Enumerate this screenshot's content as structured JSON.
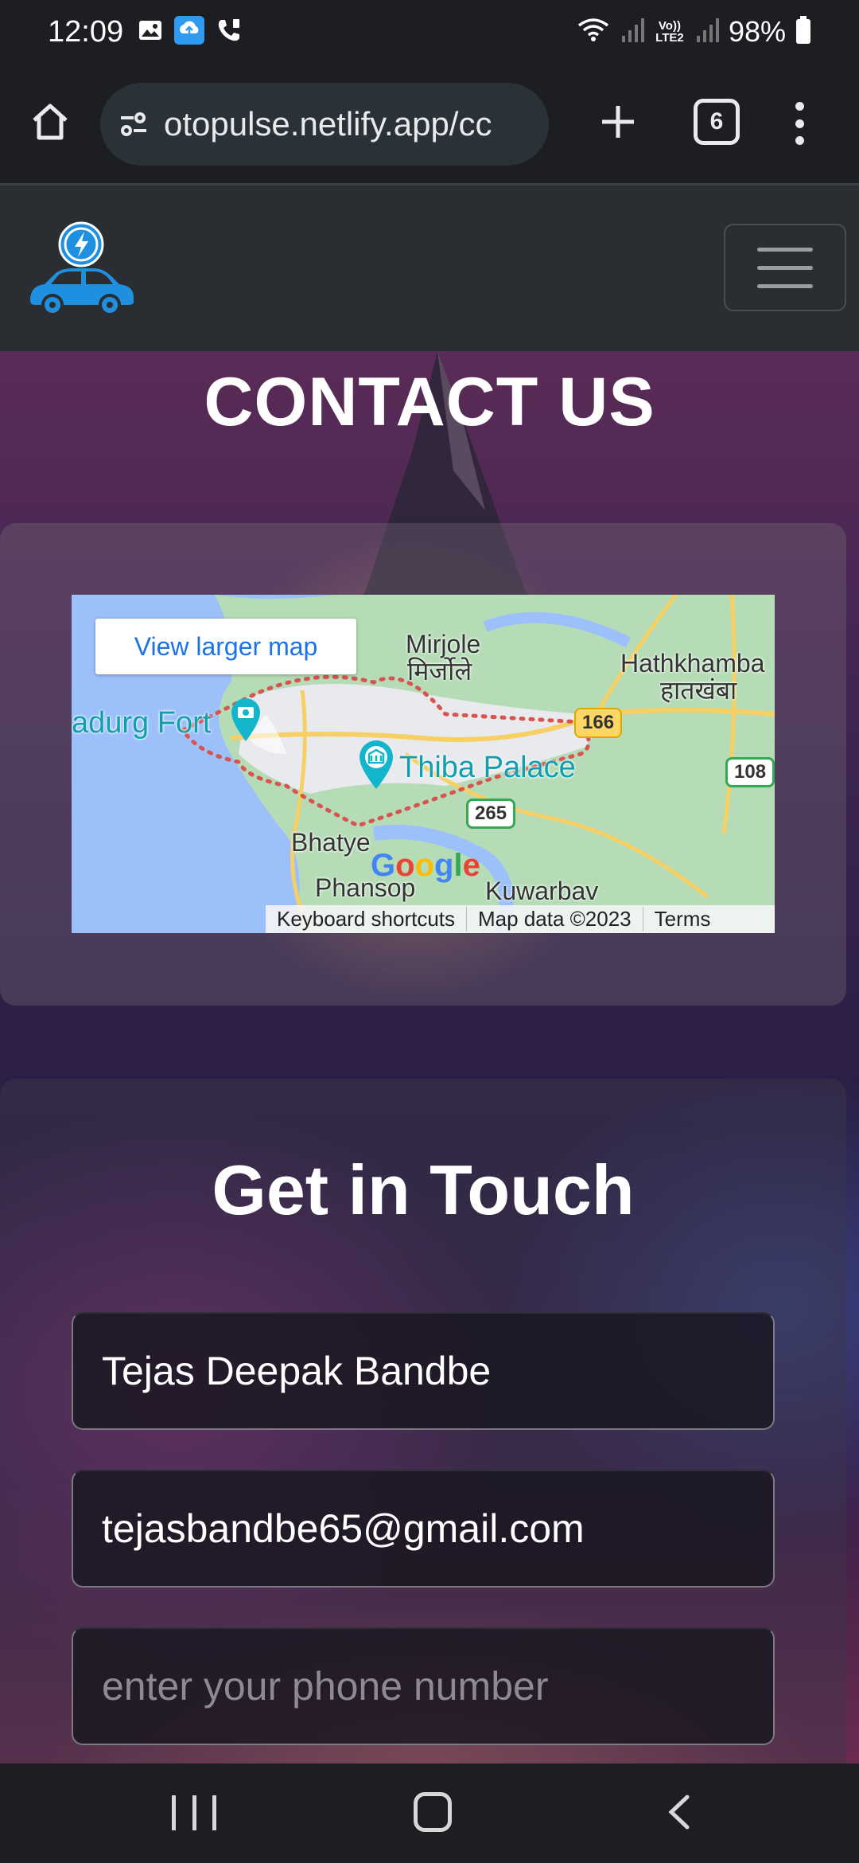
{
  "status_bar": {
    "time": "12:09",
    "battery": "98%",
    "left_icons": [
      "gallery-icon",
      "cloud-upload-icon",
      "call-icon"
    ],
    "right_icons": [
      "wifi-icon",
      "signal-icon",
      "volte-icon",
      "signal-icon",
      "battery-icon"
    ],
    "volte_label": "Vo)) LTE2"
  },
  "browser": {
    "url": "otopulse.netlify.app/cc",
    "tab_count": "6"
  },
  "page": {
    "title": "CONTACT US"
  },
  "map": {
    "view_larger_label": "View larger map",
    "labels": {
      "mirjole": "Mirjole",
      "mirjole_local": "मिर्जोले",
      "hathkhamba": "Hathkhamba",
      "hathkhamba_local": "हातखंबा",
      "fort": "adurg Fort",
      "thiba_palace": "Thiba Palace",
      "bhatye": "Bhatye",
      "phansop": "Phansop",
      "kuwarbav": "Kuwarbav"
    },
    "road_shields": [
      "166",
      "265",
      "108"
    ],
    "google": "Google",
    "footer": {
      "shortcuts": "Keyboard shortcuts",
      "data": "Map data ©2023",
      "terms": "Terms"
    }
  },
  "form": {
    "title": "Get in Touch",
    "name_value": "Tejas Deepak Bandbe",
    "email_value": "tejasbandbe65@gmail.com",
    "phone_placeholder": "enter your phone number"
  },
  "colors": {
    "accent_blue": "#1a73e8",
    "logo_blue": "#1f8fe0",
    "poi_teal": "#129eaf"
  }
}
